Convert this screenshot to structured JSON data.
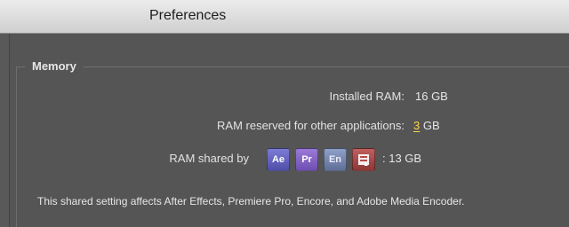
{
  "window": {
    "title": "Preferences"
  },
  "memory_group": {
    "label": "Memory",
    "installed_ram_label": "Installed RAM:",
    "installed_ram_value": "16 GB",
    "ram_reserved_label": "RAM reserved for other applications:",
    "ram_reserved_value": "3",
    "ram_reserved_unit": "GB",
    "ram_shared_label": "RAM shared by",
    "ram_shared_value": ": 13 GB",
    "apps": [
      {
        "name": "after-effects",
        "abbr": "Ae"
      },
      {
        "name": "premiere-pro",
        "abbr": "Pr"
      },
      {
        "name": "encore",
        "abbr": "En"
      },
      {
        "name": "adobe-media-encoder",
        "abbr": ""
      }
    ],
    "footer_note": "This shared setting affects After Effects, Premiere Pro, Encore, and Adobe Media Encoder."
  }
}
